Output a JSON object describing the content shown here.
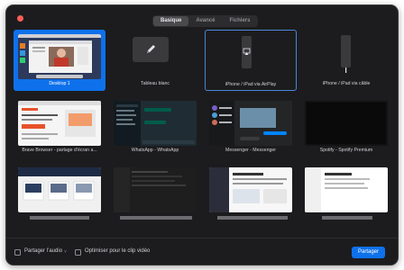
{
  "tabs": [
    {
      "label": "Basique",
      "active": true
    },
    {
      "label": "Avancé",
      "active": false
    },
    {
      "label": "Fichiers",
      "active": false
    }
  ],
  "tiles": [
    {
      "label": "Desktop 1",
      "selected": true
    },
    {
      "label": "Tableau blanc",
      "icon": "pencil-icon"
    },
    {
      "label": "iPhone / iPad via AirPlay",
      "icon": "airplay-icon"
    },
    {
      "label": "iPhone / iPad via câble",
      "icon": "phone-icon"
    },
    {
      "label": "Brave Browser - partage d’écran a..."
    },
    {
      "label": "WhatsApp - WhatsApp"
    },
    {
      "label": "Messenger - Messenger"
    },
    {
      "label": "Spotify - Spotify Premium"
    }
  ],
  "footer": {
    "audio_label": "Partager l’audio",
    "audio_chevron": "˅",
    "video_label": "Optimiser pour le clip vidéo",
    "share_button": "Partager"
  },
  "colors": {
    "accent": "#0e71eb",
    "window": "#1c1c1e"
  }
}
